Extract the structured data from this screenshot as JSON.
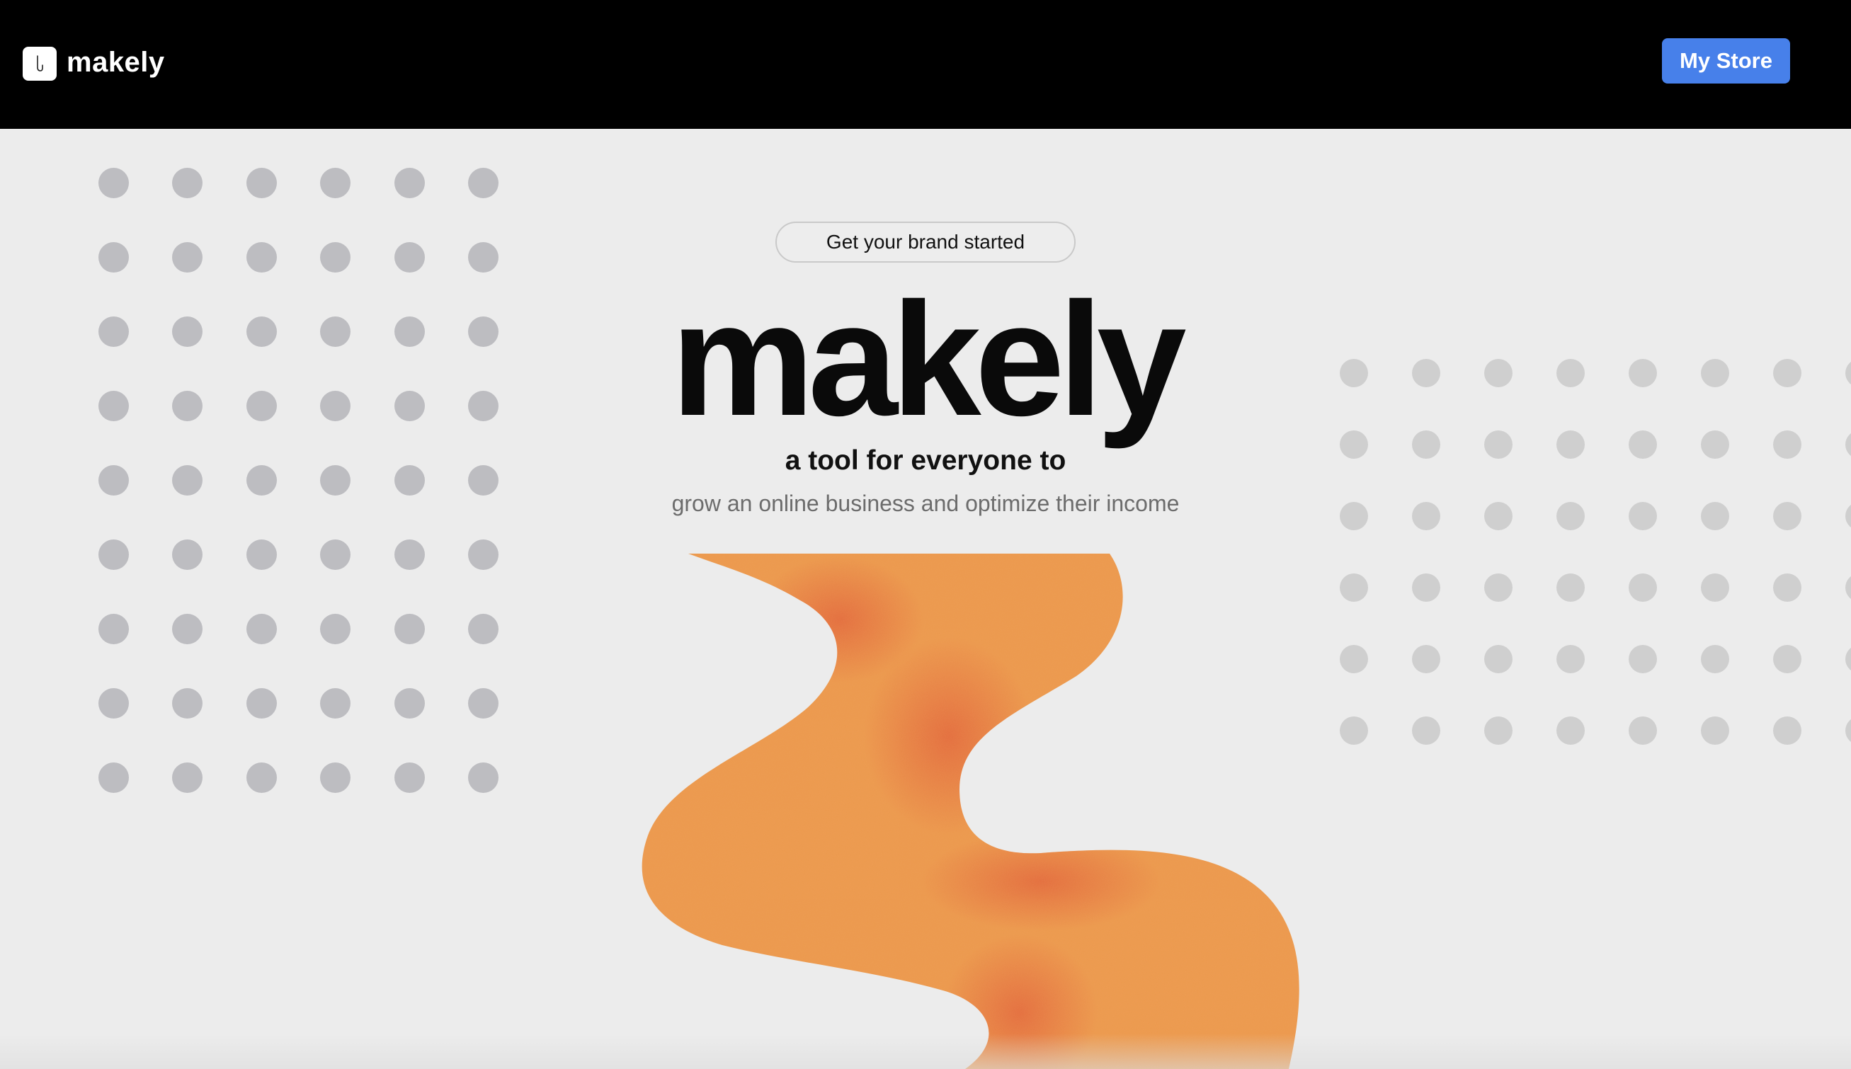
{
  "header": {
    "brand_name": "makely",
    "logo_icon": "shopping-bag-icon",
    "cta_label": "My Store",
    "background": "#000000",
    "cta_color": "#4780ea"
  },
  "hero": {
    "pill_label": "Get your brand started",
    "title": "makely",
    "tagline": "a tool for everyone to",
    "subline": "grow an online business and optimize their income"
  },
  "decor": {
    "left_dot_grid": {
      "rows": 9,
      "cols": 6,
      "color": "#bdbdc1"
    },
    "right_dot_grid": {
      "rows": 6,
      "cols": 8,
      "color": "#cfcfcf"
    },
    "swoosh_colors": [
      "#ec9a4c",
      "#e6703a"
    ],
    "swoosh_icon": "orange-swoosh-illustration"
  }
}
